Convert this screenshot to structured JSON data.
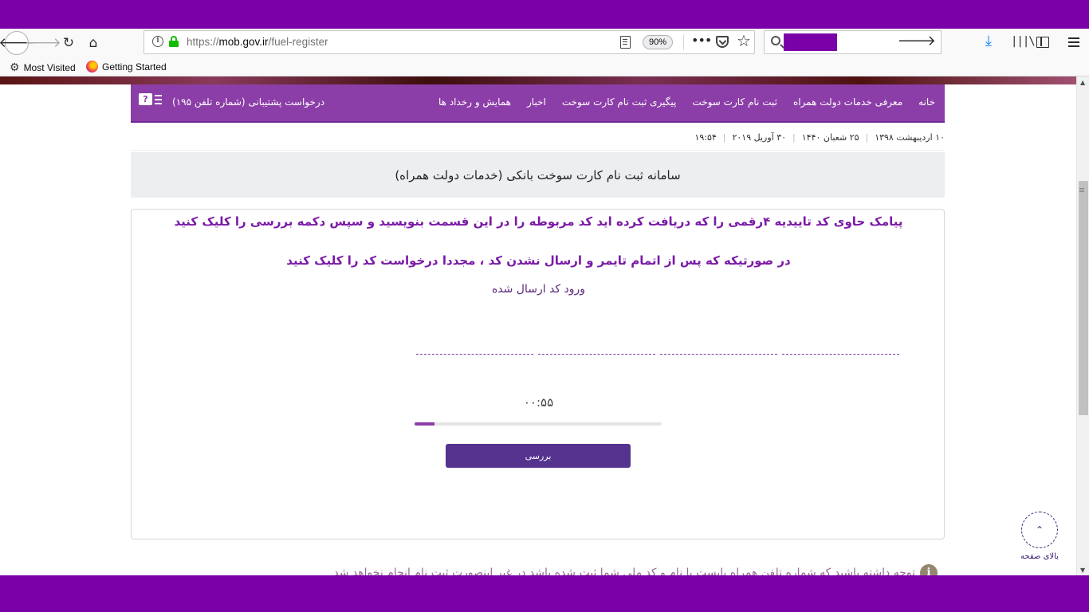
{
  "browser": {
    "url_prefix": "https://",
    "url_domain": "mob.gov.ir",
    "url_path": "/fuel-register",
    "zoom": "90%",
    "bookmarks": [
      {
        "label": "Most Visited",
        "icon": "gear-icon"
      },
      {
        "label": "Getting Started",
        "icon": "firefox-icon"
      }
    ]
  },
  "nav": {
    "items": [
      "خانه",
      "معرفی خدمات دولت همراه",
      "ثبت نام کارت سوخت",
      "پیگیری ثبت نام کارت سوخت",
      "اخبار",
      "همایش و رخداد ها"
    ],
    "support_label": "درخواست پشتیبانی (شماره تلفن ۱۹۵)"
  },
  "dateline": {
    "persian_date": "۱۰ اردیبهشت ۱۳۹۸",
    "hijri_date": "۲۵ شعبان ۱۴۴۰",
    "gregorian_date": "۳۰ آوریل ۲۰۱۹",
    "time": "۱۹:۵۴"
  },
  "page": {
    "title": "سامانه ثبت نام کارت سوخت بانکی (خدمات دولت همراه)"
  },
  "verify": {
    "message_1": "پیامک حاوی کد تاییدیه ۴رقمی را که دریافت کرده اید کد مربوطه را در این قسمت بنویسید و سپس دکمه بررسی را کلیک کنید",
    "message_2": "در صورتیکه که پس از اتمام تایمر و ارسال نشدن کد ، مجددا درخواست کد را کلیک کنید",
    "input_label": "ورود کد ارسال شده",
    "code_digits": [
      "",
      "",
      "",
      ""
    ],
    "timer": "۰۰:۵۵",
    "progress_fraction": 0.08,
    "submit_label": "بررسی"
  },
  "notice": {
    "text": "توجه داشته باشید که شماره تلفن همراه بایست با نام و کد ملی شما ثبت شده باشد در غیر اینصورت ثبت نام انجام نخواهد شد"
  },
  "back_to_top": {
    "label": "بالای صفحه"
  },
  "colors": {
    "accent": "#8c3ea8",
    "button": "#55338f",
    "message": "#7a1aa6"
  }
}
